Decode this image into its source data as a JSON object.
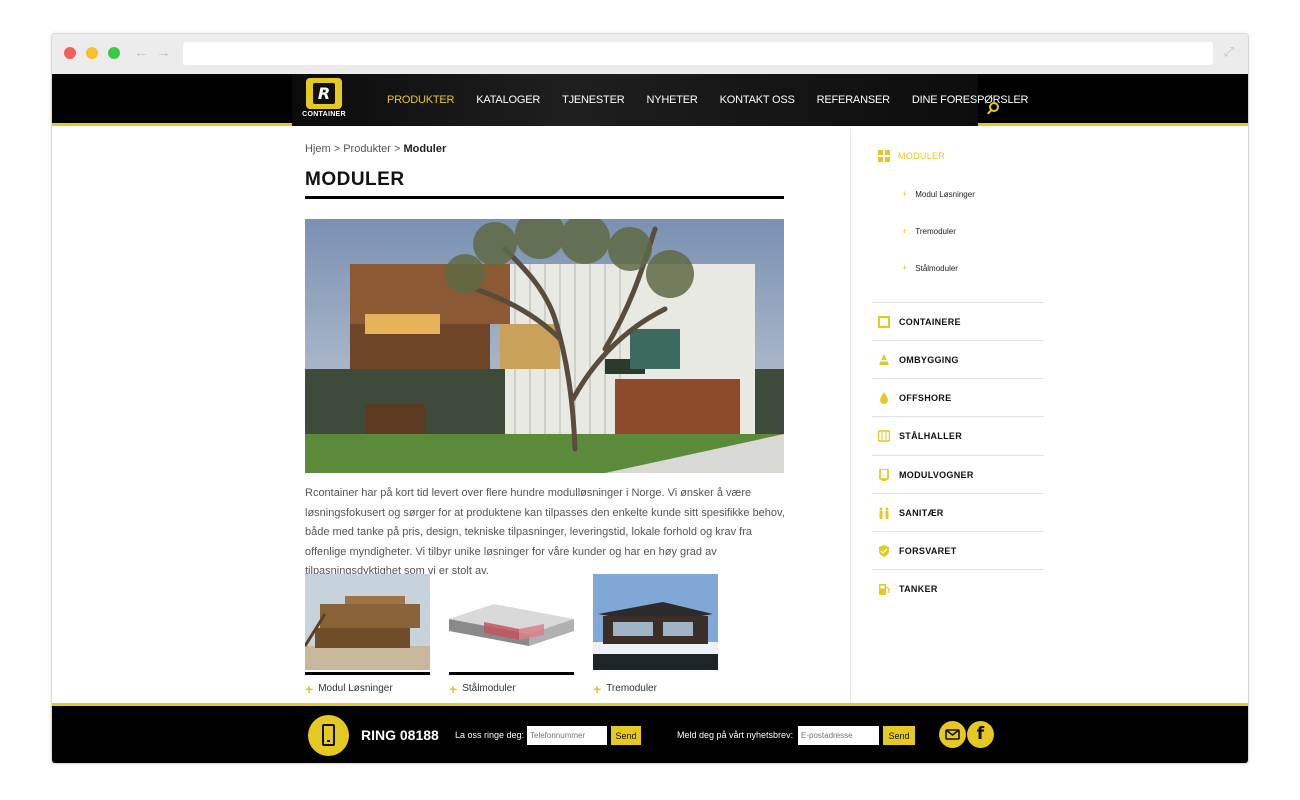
{
  "brand": {
    "logo_letter": "R",
    "logo_name": "CONTAINER",
    "accent": "#e5c922"
  },
  "nav": {
    "items": [
      {
        "label": "PRODUKTER",
        "active": true
      },
      {
        "label": "KATALOGER"
      },
      {
        "label": "TJENESTER"
      },
      {
        "label": "NYHETER"
      },
      {
        "label": "KONTAKT OSS"
      },
      {
        "label": "REFERANSER"
      },
      {
        "label": "DINE FORESPØRSLER"
      }
    ],
    "search_icon": "search-icon"
  },
  "breadcrumb": {
    "home": "Hjem",
    "sep1": " > ",
    "parent": "Produkter",
    "sep2": " > ",
    "current": "Moduler"
  },
  "page": {
    "title": "MODULER",
    "body": "Rcontainer har på kort tid levert over flere hundre modulløsninger i Norge. Vi ønsker å være løsningsfokusert og sørger for at produktene kan tilpasses den enkelte kunde sitt spesifikke behov, både med tanke på pris, design, tekniske tilpasninger, leveringstid, lokale forhold og krav fra offenlige myndigheter. Vi tilbyr unike løsninger for våre kunder og har en høy grad av tilpasningsdyktighet som vi er stolt av."
  },
  "thumbs": [
    {
      "caption": "Modul Løsninger"
    },
    {
      "caption": "Stålmoduler"
    },
    {
      "caption": "Tremoduler"
    }
  ],
  "sidebar": {
    "active": {
      "label": "MODULER",
      "sub": [
        "Modul Løsninger",
        "Tremoduler",
        "Stålmoduler"
      ]
    },
    "items": [
      {
        "label": "CONTAINERE",
        "icon": "container-icon"
      },
      {
        "label": "OMBYGGING",
        "icon": "cone-icon"
      },
      {
        "label": "OFFSHORE",
        "icon": "drop-icon"
      },
      {
        "label": "STÅLHALLER",
        "icon": "hall-icon"
      },
      {
        "label": "MODULVOGNER",
        "icon": "wagon-icon"
      },
      {
        "label": "SANITÆR",
        "icon": "toilet-icon"
      },
      {
        "label": "FORSVARET",
        "icon": "shield-icon"
      },
      {
        "label": "TANKER",
        "icon": "fuel-icon"
      }
    ]
  },
  "footer": {
    "ring": "RING 08188",
    "call_label": "La oss ringe deg:",
    "phone_placeholder": "Telefonnummer",
    "send1": "Send",
    "news_label": "Meld deg på vårt nyhetsbrev:",
    "email_placeholder": "E-postadresse",
    "send2": "Send",
    "facebook_letter": "f"
  }
}
